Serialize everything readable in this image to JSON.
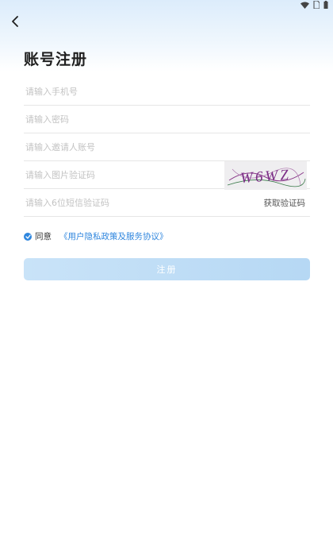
{
  "header": {
    "title": "账号注册",
    "back_icon": "chevron-left-icon"
  },
  "status_bar": {
    "icons": [
      "wifi-icon",
      "sim-icon",
      "battery-icon"
    ]
  },
  "form": {
    "phone_placeholder": "请输入手机号",
    "password_placeholder": "请输入密码",
    "invite_placeholder": "请输入邀请人账号",
    "captcha_placeholder": "请输入图片验证码",
    "captcha_code": "W6WZ",
    "sms_placeholder": "请输入6位短信验证码",
    "sms_button_label": "获取验证码"
  },
  "agreement": {
    "checked": true,
    "agree_label": "同意",
    "policy_link_label": "《用户隐私政策及服务协议》"
  },
  "register_button_label": "注册",
  "colors": {
    "accent": "#2f86de",
    "button_bg": "#c2e0f7",
    "header_gradient": "#dcecfb"
  }
}
